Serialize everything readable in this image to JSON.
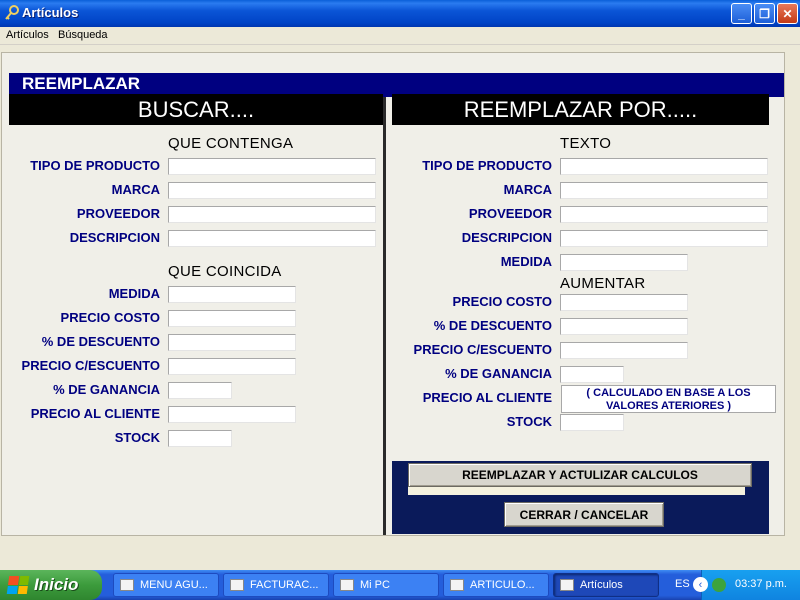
{
  "window": {
    "title": "Artículos"
  },
  "menu": [
    "Artículos",
    "Búsqueda"
  ],
  "form": {
    "banner": "REEMPLAZAR",
    "left": {
      "header": "BUSCAR....",
      "section1": "QUE CONTENGA",
      "contains": [
        "TIPO DE PRODUCTO",
        "MARCA",
        "PROVEEDOR",
        "DESCRIPCION"
      ],
      "section2": "QUE COINCIDA",
      "matches": [
        "MEDIDA",
        "PRECIO COSTO",
        "% DE DESCUENTO",
        "PRECIO C/ESCUENTO",
        "% DE GANANCIA",
        "PRECIO AL CLIENTE",
        "STOCK"
      ]
    },
    "right": {
      "header": "REEMPLAZAR POR.....",
      "section1": "TEXTO",
      "text_fields": [
        "TIPO DE PRODUCTO",
        "MARCA",
        "PROVEEDOR",
        "DESCRIPCION",
        "MEDIDA"
      ],
      "section2": "AUMENTAR",
      "increase_fields": [
        "PRECIO COSTO",
        "% DE DESCUENTO",
        "PRECIO C/ESCUENTO",
        "% DE GANANCIA",
        "PRECIO AL CLIENTE",
        "STOCK"
      ],
      "note": "( CALCULADO EN BASE A LOS VALORES ATERIORES )"
    },
    "buttons": {
      "replace": "REEMPLAZAR Y ACTULIZAR CALCULOS",
      "close": "CERRAR / CANCELAR"
    }
  },
  "taskbar": {
    "start": "Inicio",
    "tasks": [
      "MENU AGU...",
      "FACTURAC...",
      "Mi PC",
      "ARTICULO...",
      "Artículos"
    ],
    "lang": "ES",
    "time": "03:37 p.m."
  }
}
